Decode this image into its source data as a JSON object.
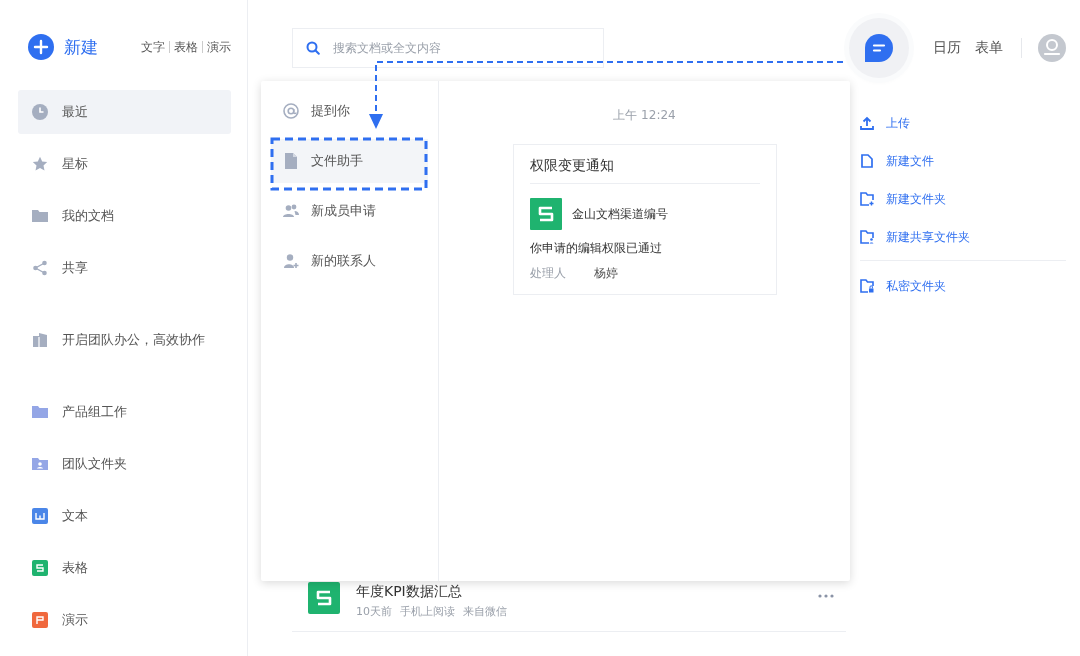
{
  "sidebar": {
    "new_button": "新建",
    "quick_links": [
      "文字",
      "表格",
      "演示"
    ],
    "sections": [
      [
        {
          "label": "最近",
          "kind": "clock",
          "selected": true
        },
        {
          "label": "星标",
          "kind": "star",
          "selected": false
        },
        {
          "label": "我的文档",
          "kind": "folder",
          "selected": false
        },
        {
          "label": "共享",
          "kind": "share",
          "selected": false
        }
      ],
      [
        {
          "label": "开启团队办公，高效协作",
          "kind": "building",
          "selected": false
        }
      ],
      [
        {
          "label": "产品组工作",
          "kind": "team-folder",
          "selected": false
        },
        {
          "label": "团队文件夹",
          "kind": "person-folder",
          "selected": false
        },
        {
          "label": "文本",
          "kind": "doc",
          "selected": false
        },
        {
          "label": "表格",
          "kind": "sheet",
          "selected": false
        },
        {
          "label": "演示",
          "kind": "slides",
          "selected": false
        }
      ]
    ]
  },
  "search": {
    "placeholder": "搜索文档或全文内容"
  },
  "header_links": [
    "日历",
    "表单"
  ],
  "actions": [
    [
      {
        "label": "上传",
        "kind": "upload"
      },
      {
        "label": "新建文件",
        "kind": "file"
      },
      {
        "label": "新建文件夹",
        "kind": "folder-plus"
      },
      {
        "label": "新建共享文件夹",
        "kind": "folder-share"
      }
    ],
    [
      {
        "label": "私密文件夹",
        "kind": "folder-lock"
      }
    ]
  ],
  "files": [
    {
      "title": "年度KPI数据汇总",
      "kind": "sheet",
      "meta": [
        "10天前",
        "手机上阅读",
        "来自微信"
      ]
    }
  ],
  "popup": {
    "nav": [
      {
        "label": "提到你",
        "kind": "at",
        "selected": false
      },
      {
        "label": "文件助手",
        "kind": "file",
        "selected": true
      },
      {
        "label": "新成员申请",
        "kind": "people",
        "selected": false
      },
      {
        "label": "新的联系人",
        "kind": "person-add",
        "selected": false
      }
    ],
    "time": "上午 12:24",
    "card": {
      "title": "权限变更通知",
      "doc": "金山文档渠道编号",
      "text": "你申请的编辑权限已通过",
      "handler_label": "处理人",
      "handler": "杨婷"
    }
  }
}
